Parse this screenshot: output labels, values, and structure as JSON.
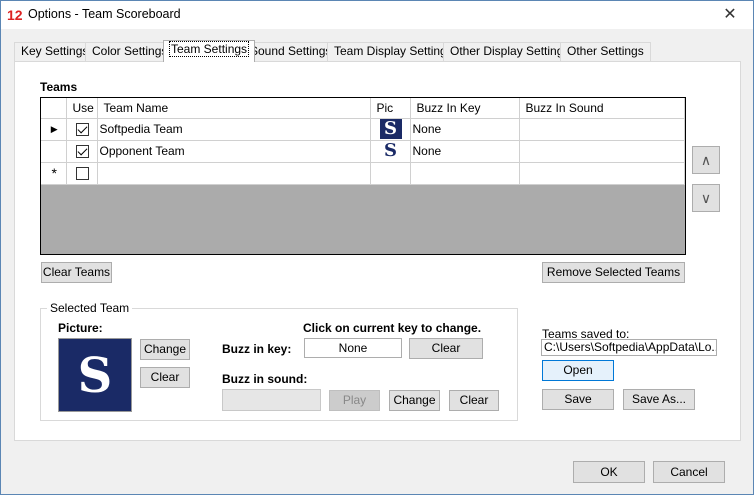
{
  "window": {
    "title": "Options - Team Scoreboard",
    "app_icon": "12",
    "close_glyph": "✕"
  },
  "tabs": [
    {
      "label": "Key Settings"
    },
    {
      "label": "Color Settings"
    },
    {
      "label": "Team Settings",
      "active": true
    },
    {
      "label": "Sound Settings"
    },
    {
      "label": "Team Display Settings"
    },
    {
      "label": "Other Display Settings"
    },
    {
      "label": "Other Settings"
    }
  ],
  "teams": {
    "heading": "Teams",
    "columns": [
      "Use",
      "Team Name",
      "Pic",
      "Buzz In Key",
      "Buzz In Sound"
    ],
    "rows": [
      {
        "marker": "▶",
        "use": true,
        "name": "Softpedia Team",
        "pic": "S",
        "buzz_key": "None",
        "buzz_sound": ""
      },
      {
        "marker": "",
        "use": true,
        "name": "Opponent Team",
        "pic": "S",
        "buzz_key": "None",
        "buzz_sound": ""
      },
      {
        "marker": "*",
        "use": false,
        "name": "",
        "pic": "",
        "buzz_key": "",
        "buzz_sound": ""
      }
    ],
    "move_up_glyph": "∧",
    "move_down_glyph": "∨",
    "clear_teams_label": "Clear Teams",
    "remove_selected_label": "Remove Selected Teams"
  },
  "selected_team": {
    "title": "Selected Team",
    "picture_label": "Picture:",
    "picture_glyph": "S",
    "change_label": "Change",
    "clear_label": "Clear",
    "hint": "Click on current key to change.",
    "buzz_key_label": "Buzz in key:",
    "buzz_key_value": "None",
    "buzz_key_clear": "Clear",
    "buzz_sound_label": "Buzz in sound:",
    "buzz_sound_value": "",
    "play_label": "Play",
    "sound_change_label": "Change",
    "sound_clear_label": "Clear"
  },
  "saved": {
    "label": "Teams saved to:",
    "path": "C:\\Users\\Softpedia\\AppData\\Lo...",
    "open_label": "Open",
    "save_label": "Save",
    "save_as_label": "Save As..."
  },
  "footer": {
    "ok_label": "OK",
    "cancel_label": "Cancel"
  },
  "colors": {
    "accent": "#0078d7",
    "picture_bg": "#1a2a66",
    "grid_empty": "#ababab"
  }
}
